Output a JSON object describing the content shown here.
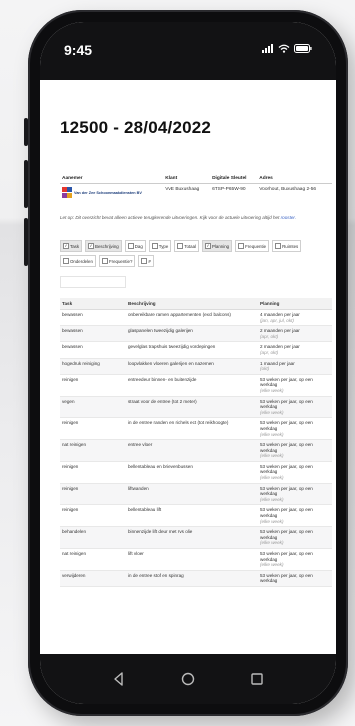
{
  "statusbar": {
    "time": "9:45"
  },
  "page": {
    "title": "12500 - 28/04/2022"
  },
  "info": {
    "headers": [
      "Aanemer",
      "Klant",
      "Digitale Sleutel",
      "Adres"
    ],
    "company": "Van der Zee Schoonmaakdiensten BV",
    "client": "VvE Buxushaag",
    "key": "6TSP-P65W-90",
    "address": "Voorhout, Buxushaag 2-56"
  },
  "notice": {
    "text": "Let op: Dit overzicht bevat alleen actieve terugkerende uitvoeringen. Kijk voor de actuele uitvoering altijd het ",
    "link": "rooster."
  },
  "toggles": [
    {
      "label": "Task",
      "checked": true
    },
    {
      "label": "Beschrijving",
      "checked": true
    },
    {
      "label": "Dag",
      "checked": false
    },
    {
      "label": "Type",
      "checked": false
    },
    {
      "label": "Totaal",
      "checked": false
    },
    {
      "label": "Planning",
      "checked": true
    },
    {
      "label": "Frequentie",
      "checked": false
    },
    {
      "label": "Ruimtes",
      "checked": false
    },
    {
      "label": "Onderdelen",
      "checked": false
    },
    {
      "label": "Frequentie?",
      "checked": false
    },
    {
      "label": "#",
      "checked": false
    }
  ],
  "table": {
    "headers": [
      "Task",
      "Beschrijving",
      "Planning"
    ],
    "rows": [
      {
        "task": "bewassen",
        "desc": "onbereikbare ramen appartementen (excl balcons)",
        "plan": "4 maanden per jaar",
        "note": "(jan, apr, jul, okt)"
      },
      {
        "task": "bewassen",
        "desc": "glaspanelen tweezijdig galerijen",
        "plan": "2 maanden per jaar",
        "note": "(apr, okt)"
      },
      {
        "task": "bewassen",
        "desc": "gevelglas trapshuis tweezijdig vordepingen",
        "plan": "2 maanden per jaar",
        "note": "(apr, okt)"
      },
      {
        "task": "hogedruk reiniging",
        "desc": "loopvlakken vloeren galerijen en nazemen",
        "plan": "1 maand per jaar",
        "note": "(okt)"
      },
      {
        "task": "reinigen",
        "desc": "entreedeur binnen- en buitenzijde",
        "plan": "53 weken per jaar, op een werkdag",
        "note": "(elke week)"
      },
      {
        "task": "vegen",
        "desc": "straat voor de entree (tot 2 meter)",
        "plan": "53 weken per jaar, op een werkdag",
        "note": "(elke week)"
      },
      {
        "task": "reinigen",
        "desc": "in de entree randen en richels ect (tot reikhoogte)",
        "plan": "53 weken per jaar, op een werkdag",
        "note": "(elke week)"
      },
      {
        "task": "nat reinigen",
        "desc": "entree vloer",
        "plan": "53 weken per jaar, op een werkdag",
        "note": "(elke week)"
      },
      {
        "task": "reinigen",
        "desc": "bellentableau en brievenbussen",
        "plan": "53 weken per jaar, op een werkdag",
        "note": "(elke week)"
      },
      {
        "task": "reinigen",
        "desc": "liftwanden",
        "plan": "53 weken per jaar, op een werkdag",
        "note": "(elke week)"
      },
      {
        "task": "reinigen",
        "desc": "bellentableau lift",
        "plan": "53 weken per jaar, op een werkdag",
        "note": "(elke week)"
      },
      {
        "task": "behandelen",
        "desc": "binnenzijde lift deur met rvs olie",
        "plan": "53 weken per jaar, op een werkdag",
        "note": "(elke week)"
      },
      {
        "task": "nat reinigen",
        "desc": "lift vloer",
        "plan": "53 weken per jaar, op een werkdag",
        "note": "(elke week)"
      },
      {
        "task": "verwijderen",
        "desc": "in de entree stof en spinrag",
        "plan": "53 weken per jaar, op een werkdag",
        "note": ""
      }
    ]
  }
}
